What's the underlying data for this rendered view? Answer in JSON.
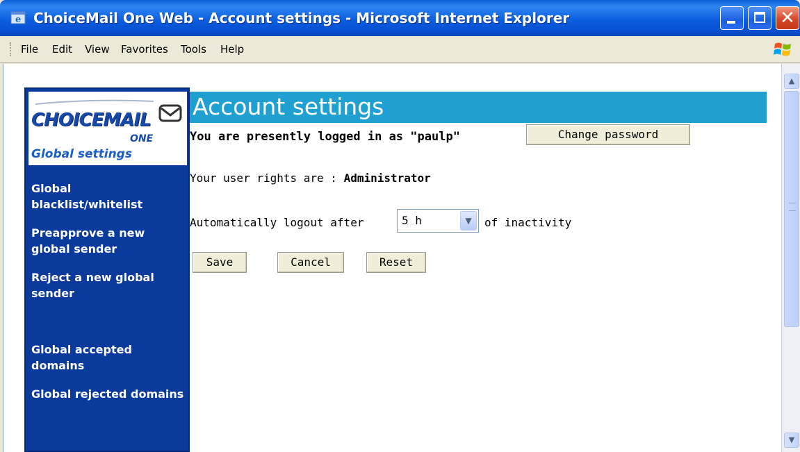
{
  "window": {
    "title": "ChoiceMail One Web - Account settings - Microsoft Internet Explorer",
    "close_glyph": "✕"
  },
  "menu": {
    "items": [
      "File",
      "Edit",
      "View",
      "Favorites",
      "Tools",
      "Help"
    ]
  },
  "sidebar": {
    "logo": {
      "brand": "CHOICEMAIL",
      "edition": "ONE",
      "section": "Global settings"
    },
    "items": [
      {
        "label": "Global blacklist/whitelist"
      },
      {
        "label": "Preapprove a new global sender"
      },
      {
        "label": "Reject a new global sender"
      },
      {
        "label": "Global accepted domains"
      },
      {
        "label": "Global rejected domains"
      }
    ]
  },
  "main": {
    "title": "Account settings",
    "login_status": "You are presently logged in as \"paulp\"",
    "change_password_label": "Change password",
    "rights_prefix": "Your user rights are : ",
    "rights_value": "Administrator",
    "logout_prefix": "Automatically logout after",
    "logout_value": "5 h",
    "logout_suffix": "of inactivity",
    "buttons": {
      "save": "Save",
      "cancel": "Cancel",
      "reset": "Reset"
    }
  },
  "colors": {
    "sidebar_bg": "#0a3a9c",
    "title_bar_bg": "#209fd1",
    "titlebar_blue": "#0c5fe0"
  },
  "icons": {
    "window": "ie-icon",
    "logo": "envelope-icon",
    "windows_flag": "windows-logo-icon"
  }
}
